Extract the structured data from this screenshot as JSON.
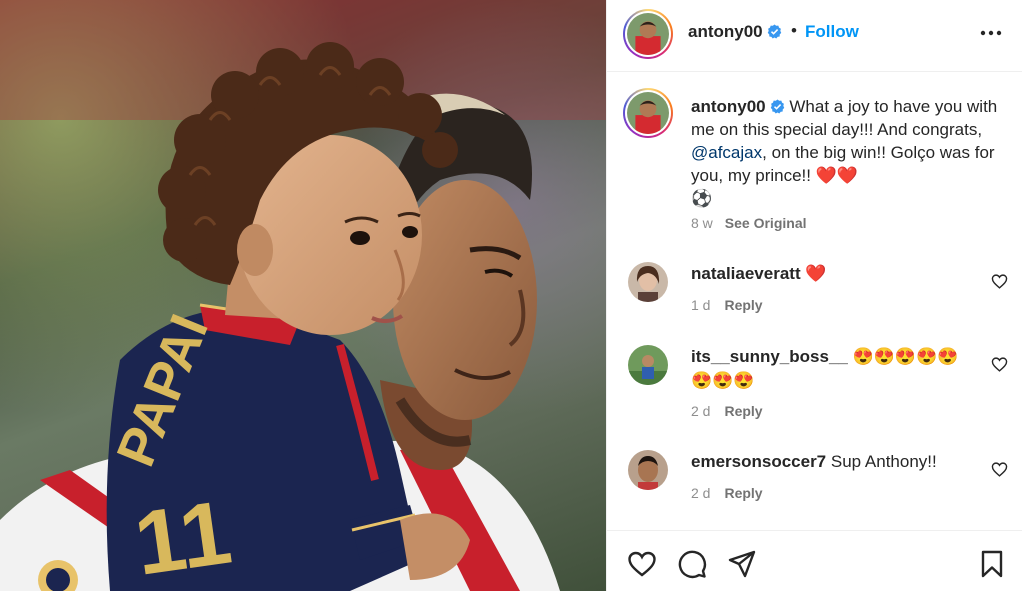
{
  "post": {
    "username": "antony00",
    "follow_label": "Follow",
    "dot": "•"
  },
  "caption": {
    "username": "antony00",
    "text_1": "What a joy to have you with me on this special day!!! And congrats, ",
    "mention": "@afcajax",
    "text_2": ", on the big win!! Golço was for you, my prince!! ",
    "emojis": "❤️❤️",
    "emoji_ball": "⚽",
    "time": "8 w",
    "see_original": "See Original"
  },
  "comments": [
    {
      "username": "nataliaeveratt",
      "text": "",
      "emoji": "❤️",
      "time": "1 d",
      "reply": "Reply"
    },
    {
      "username": "its__sunny_boss__",
      "text": "",
      "emoji": "😍😍😍😍😍 😍😍😍",
      "time": "2 d",
      "reply": "Reply"
    },
    {
      "username": "emersonsoccer7",
      "text": "Sup Anthony!!",
      "emoji": "",
      "time": "2 d",
      "reply": "Reply"
    }
  ],
  "photo": {
    "jersey_text": "PAPAI",
    "jersey_number": "11"
  },
  "icons": {
    "verified": "verified-badge-icon",
    "more": "more-options-icon",
    "like": "heart-icon",
    "comment": "comment-icon",
    "share": "share-icon",
    "save": "bookmark-icon"
  },
  "colors": {
    "follow": "#0095f6",
    "verified": "#3897f0",
    "heart_red": "#ed4956",
    "mention": "#00376b",
    "muted": "#8e8e8e"
  }
}
